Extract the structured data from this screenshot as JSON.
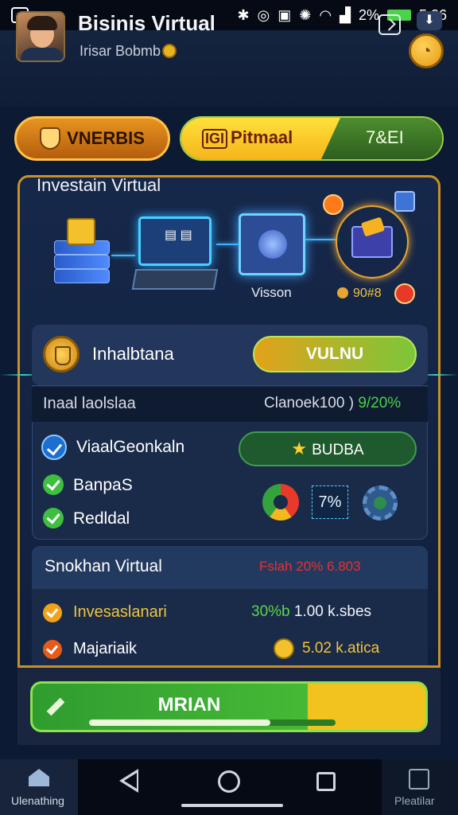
{
  "status_bar": {
    "left_icon": "app-icon",
    "battery": "2%",
    "time": "5:26"
  },
  "header": {
    "title": "Bisinis Virtual",
    "subtitle": "Irisar Bobmb"
  },
  "tabs": {
    "left": "VNERBIS",
    "right_yellow_mark": "IGI",
    "right_yellow": "Pitmaal",
    "right_green": "7&EI"
  },
  "panel": {
    "title": "Investain Virtual",
    "illustration_label": "Visson",
    "illustration_value": "90#8"
  },
  "status_row": {
    "label": "Inhalbtana",
    "button": "VULNU"
  },
  "detail": {
    "header_left": "Inaal laolslaa",
    "header_right": "Clanoek100",
    "header_right_value": "9/20%",
    "main_item": "ViaalGeonkaln",
    "item1": "BanpaS",
    "item2": "Redldal",
    "bonus_button": "BUDBA",
    "percent": "7%"
  },
  "simulation": {
    "title": "Snokhan Virtual",
    "stat": "Fslah 20% 6.803",
    "rows": [
      {
        "label": "Invesaslanari",
        "value_green": "30%b",
        "value": "1.00 k.sbes"
      },
      {
        "label": "Majariaik",
        "value": "5.02 k.atica"
      }
    ]
  },
  "cta": {
    "label": "MRIAN"
  },
  "bottom_nav": {
    "left_label": "Ulenathing",
    "right_label": "Pleatilar"
  },
  "colors": {
    "gold": "#c98f27",
    "green": "#46b936",
    "panel": "#16284a"
  }
}
